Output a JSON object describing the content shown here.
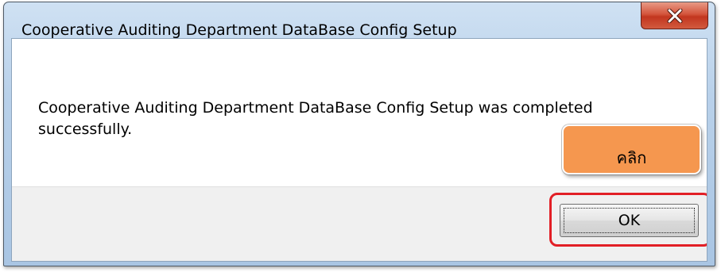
{
  "window": {
    "title": "Cooperative Auditing Department DataBase Config Setup",
    "close_glyph": "x"
  },
  "message": {
    "text": "Cooperative Auditing Department DataBase Config Setup was completed successfully."
  },
  "buttons": {
    "ok_label": "OK"
  },
  "annotation": {
    "callout_text": "คลิก",
    "callout_color": "#f5974f",
    "highlight_color": "#e21f26"
  },
  "icons": {
    "close": "close-icon"
  }
}
